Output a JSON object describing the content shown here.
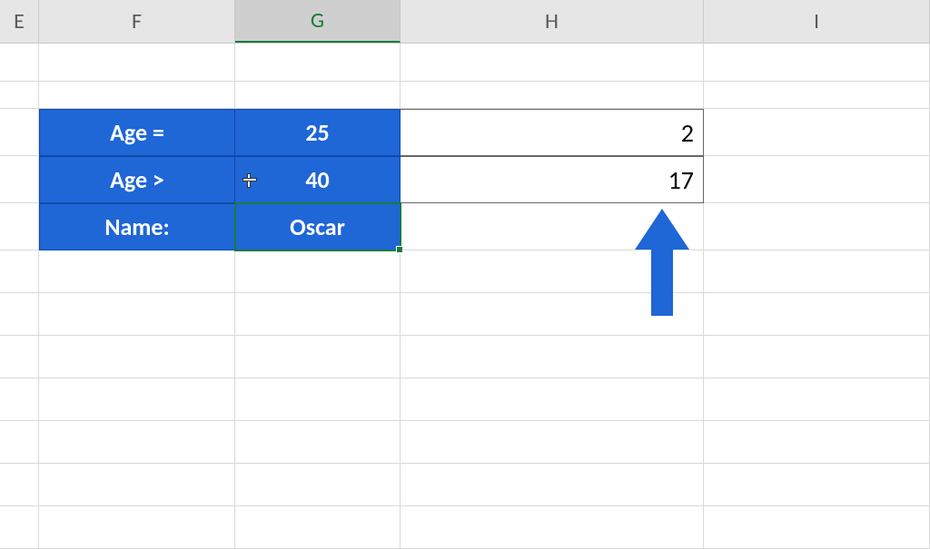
{
  "columns": {
    "E": "E",
    "F": "F",
    "G": "G",
    "H": "H",
    "I": "I"
  },
  "cells": {
    "F3": "Age =",
    "G3": "25",
    "H3": "2",
    "F4": "Age >",
    "G4": "40",
    "H4": "17",
    "F5": "Name:",
    "G5": "Oscar"
  },
  "selected_cell": "G5",
  "cursor_over": "G4",
  "colors": {
    "fill_blue": "#1f66d6",
    "selection_green": "#187c3e",
    "arrow_blue": "#1f66d6"
  }
}
